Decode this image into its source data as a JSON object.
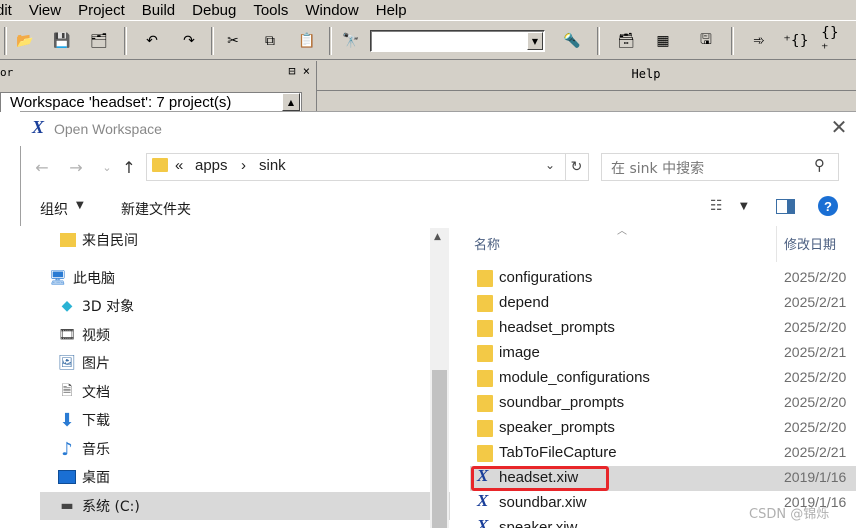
{
  "menubar": [
    "dit",
    "View",
    "Project",
    "Build",
    "Debug",
    "Tools",
    "Window",
    "Help"
  ],
  "workspace": {
    "panel_title": "or",
    "pin": "⊟ ×",
    "tree_root": "Workspace 'headset': 7 project(s)"
  },
  "help_panel": {
    "title": "Help"
  },
  "dialog": {
    "title": "Open Workspace",
    "close_glyph": "✕",
    "breadcrumb": [
      "«",
      "apps",
      "›",
      "sink"
    ],
    "search_placeholder": "在 sink 中搜索",
    "command_organize": "组织",
    "command_new_folder": "新建文件夹",
    "help_glyph": "?",
    "nav_items": [
      {
        "label": "来自民间",
        "icon": "folder-icon"
      },
      {
        "label": "此电脑",
        "icon": "computer-icon"
      },
      {
        "label": "3D 对象",
        "icon": "cube-icon"
      },
      {
        "label": "视频",
        "icon": "film-icon"
      },
      {
        "label": "图片",
        "icon": "picture-icon"
      },
      {
        "label": "文档",
        "icon": "document-icon"
      },
      {
        "label": "下载",
        "icon": "download-icon"
      },
      {
        "label": "音乐",
        "icon": "music-icon"
      },
      {
        "label": "桌面",
        "icon": "desktop-icon"
      },
      {
        "label": "系统 (C:)",
        "icon": "drive-icon"
      }
    ],
    "columns": {
      "name": "名称",
      "date": "修改日期"
    },
    "files": [
      {
        "name": "configurations",
        "date": "2025/2/20",
        "type": "folder"
      },
      {
        "name": "depend",
        "date": "2025/2/21",
        "type": "folder"
      },
      {
        "name": "headset_prompts",
        "date": "2025/2/20",
        "type": "folder"
      },
      {
        "name": "image",
        "date": "2025/2/21",
        "type": "folder"
      },
      {
        "name": "module_configurations",
        "date": "2025/2/20",
        "type": "folder"
      },
      {
        "name": "soundbar_prompts",
        "date": "2025/2/20",
        "type": "folder"
      },
      {
        "name": "speaker_prompts",
        "date": "2025/2/20",
        "type": "folder"
      },
      {
        "name": "TabToFileCapture",
        "date": "2025/2/21",
        "type": "folder"
      },
      {
        "name": "headset.xiw",
        "date": "2019/1/16",
        "type": "xiw"
      },
      {
        "name": "soundbar.xiw",
        "date": "2019/1/16",
        "type": "xiw"
      },
      {
        "name": "speaker.xiw",
        "date": "",
        "type": "xiw"
      }
    ]
  },
  "watermark": "CSDN @锦烁",
  "colors": {
    "highlight_box": "#e8262a",
    "folder": "#f3c946",
    "selection": "#d9d9d9",
    "xiw_icon": "#1a3f9a"
  }
}
